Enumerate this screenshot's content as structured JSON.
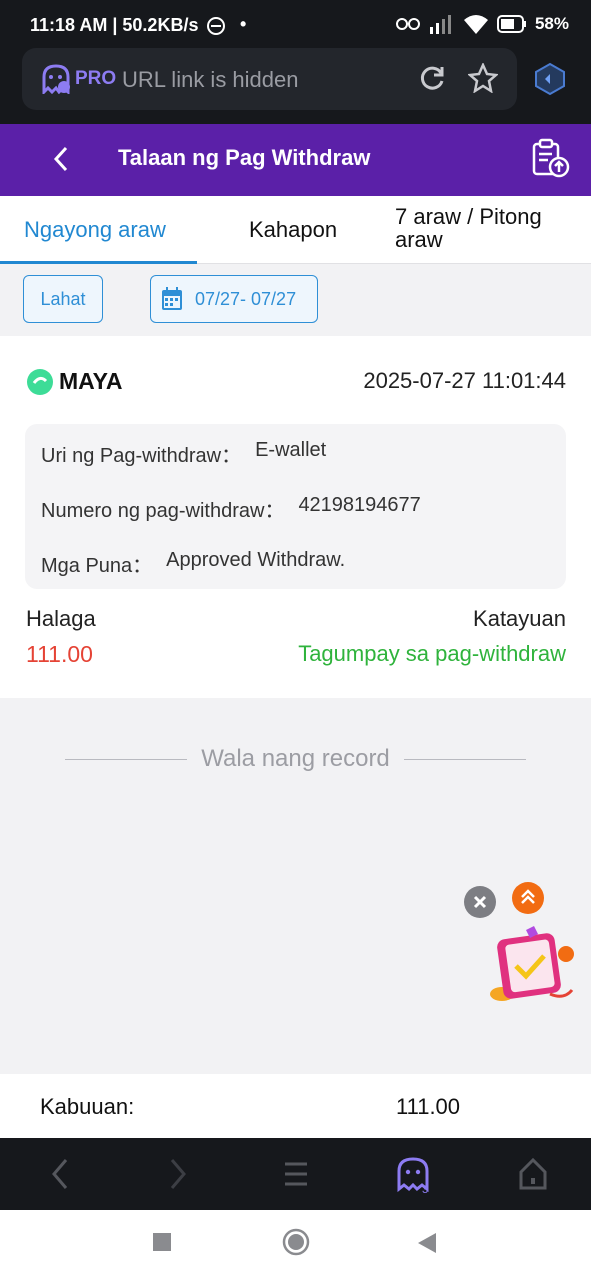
{
  "status": {
    "time": "11:18 AM | 50.2KB/s",
    "battery": "58%"
  },
  "browser": {
    "pro_label": "PRO",
    "url_text": "URL link is hidden",
    "tab_count": "3"
  },
  "header": {
    "title": "Talaan ng Pag Withdraw"
  },
  "tabs": [
    {
      "label": "Ngayong araw",
      "active": true
    },
    {
      "label": "Kahapon",
      "active": false
    },
    {
      "label": "7 araw / Pitong araw",
      "active": false
    }
  ],
  "filters": {
    "all_label": "Lahat",
    "date_range": "07/27- 07/27"
  },
  "record": {
    "provider": "MAYA",
    "datetime": "2025-07-27 11:01:44",
    "type_label": "Uri ng Pag-withdraw：",
    "type_value": "E-wallet",
    "number_label": "Numero ng pag-withdraw：",
    "number_value": "42198194677",
    "remarks_label": "Mga Puna：",
    "remarks_value": "Approved Withdraw.",
    "amount_label": "Halaga",
    "amount_value": "111.00",
    "status_label": "Katayuan",
    "status_value": "Tagumpay sa pag-withdraw"
  },
  "no_record_text": "Wala nang record",
  "total": {
    "label": "Kabuuan:",
    "value": "111.00"
  },
  "colors": {
    "header_bg": "#5b20a8",
    "accent": "#2188d1",
    "amount": "#e54335",
    "success": "#2fb33c"
  },
  "icons": [
    "pro-ghost-icon",
    "reload-icon",
    "star-icon",
    "shield-icon",
    "back-arrow-icon",
    "export-icon",
    "calendar-icon",
    "maya-logo-icon",
    "close-icon",
    "chevron-up-icon",
    "gift-box-icon",
    "nav-back-icon",
    "nav-forward-icon",
    "menu-icon",
    "ghost-tabs-icon",
    "home-icon",
    "recent-apps-icon",
    "system-home-icon",
    "system-back-icon"
  ]
}
